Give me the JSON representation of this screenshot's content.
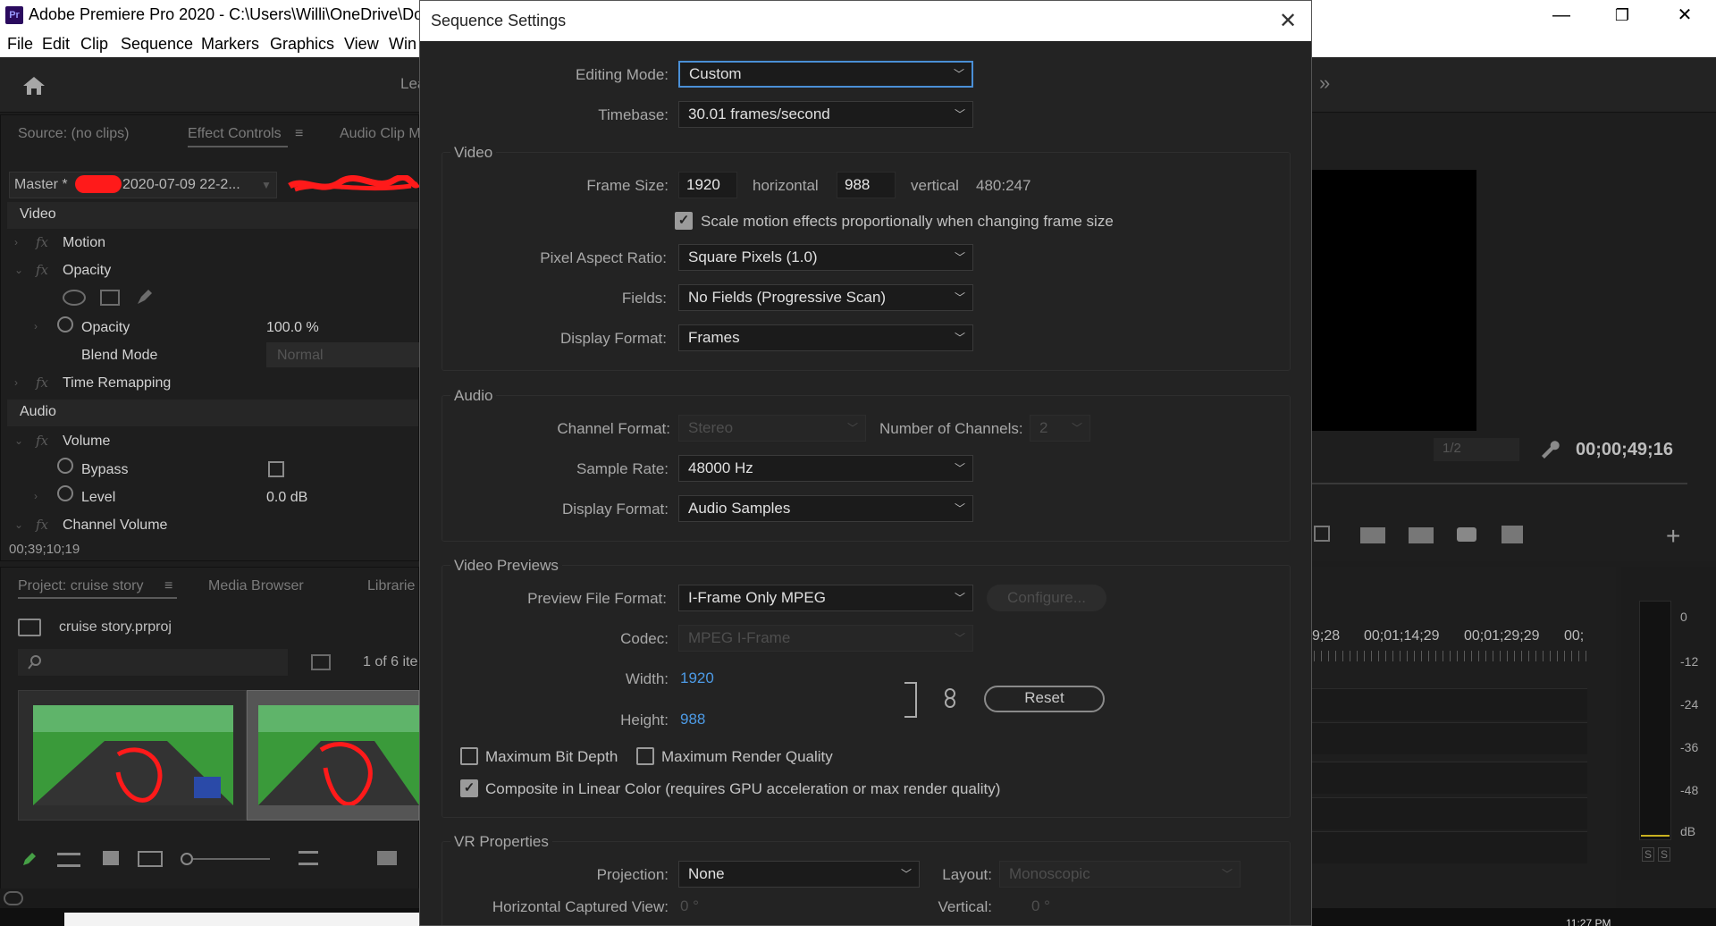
{
  "window": {
    "logo": "Pr",
    "title": "Adobe Premiere Pro 2020 - C:\\Users\\Willi\\OneDrive\\Do",
    "minimize": "—",
    "maximize": "❐",
    "close": "✕"
  },
  "menu": [
    "File",
    "Edit",
    "Clip",
    "Sequence",
    "Markers",
    "Graphics",
    "View",
    "Win"
  ],
  "workspace": {
    "partial_tab": "Lea",
    "overflow": "»"
  },
  "source_panel": {
    "tabs": [
      "Source: (no clips)",
      "Effect Controls",
      "Audio Clip M"
    ],
    "tab_menu": "≡",
    "master": "Master *",
    "clip": "2020-07-09 22-2...",
    "video_header": "Video",
    "motion": "Motion",
    "opacity_group": "Opacity",
    "opacity_label": "Opacity",
    "opacity_value": "100.0 %",
    "blend_mode_label": "Blend Mode",
    "blend_mode_value": "Normal",
    "time_remapping": "Time Remapping",
    "audio_header": "Audio",
    "volume": "Volume",
    "bypass": "Bypass",
    "level_label": "Level",
    "level_value": "0.0 dB",
    "channel_volume": "Channel Volume",
    "fx_symbol": "fx",
    "timecode": "00;39;10;19"
  },
  "project_panel": {
    "tabs": [
      "Project: cruise story",
      "Media Browser",
      "Librarie"
    ],
    "tab_menu": "≡",
    "project_file": "cruise story.prproj",
    "item_count": "1 of 6 ite",
    "search_placeholder": ""
  },
  "program_monitor": {
    "resolution": "1/2",
    "timecode": "00;00;49;16",
    "add": "+"
  },
  "timeline": {
    "times": [
      "9;28",
      "00;01;14;29",
      "00;01;29;29",
      "00;"
    ]
  },
  "audio_meter": {
    "labels": [
      "0",
      "-12",
      "-24",
      "-36",
      "-48",
      "dB"
    ],
    "solo_buttons": [
      "S",
      "S"
    ]
  },
  "dialog": {
    "title": "Sequence Settings",
    "close": "✕",
    "editing_mode_label": "Editing Mode:",
    "editing_mode_value": "Custom",
    "timebase_label": "Timebase:",
    "timebase_value": "30.01  frames/second",
    "video": {
      "title": "Video",
      "frame_size_label": "Frame Size:",
      "frame_width": "1920",
      "horizontal_label": "horizontal",
      "frame_height": "988",
      "vertical_label": "vertical",
      "aspect": "480:247",
      "scale_motion_label": "Scale motion effects proportionally when changing frame size",
      "scale_motion_checked": true,
      "pixel_aspect_label": "Pixel Aspect Ratio:",
      "pixel_aspect_value": "Square Pixels (1.0)",
      "fields_label": "Fields:",
      "fields_value": "No Fields (Progressive Scan)",
      "display_format_label": "Display Format:",
      "display_format_value": "Frames"
    },
    "audio": {
      "title": "Audio",
      "channel_format_label": "Channel Format:",
      "channel_format_value": "Stereo",
      "num_channels_label": "Number of Channels:",
      "num_channels_value": "2",
      "sample_rate_label": "Sample Rate:",
      "sample_rate_value": "48000 Hz",
      "display_format_label": "Display Format:",
      "display_format_value": "Audio Samples"
    },
    "previews": {
      "title": "Video Previews",
      "file_format_label": "Preview File Format:",
      "file_format_value": "I-Frame Only MPEG",
      "configure": "Configure...",
      "codec_label": "Codec:",
      "codec_value": "MPEG I-Frame",
      "width_label": "Width:",
      "width_value": "1920",
      "height_label": "Height:",
      "height_value": "988",
      "reset": "Reset",
      "max_bit_depth": "Maximum Bit Depth",
      "max_render_quality": "Maximum Render Quality",
      "composite_linear": "Composite in Linear Color (requires GPU acceleration or max render quality)",
      "composite_checked": true
    },
    "vr": {
      "title": "VR Properties",
      "projection_label": "Projection:",
      "projection_value": "None",
      "layout_label": "Layout:",
      "layout_value": "Monoscopic",
      "h_view_label": "Horizontal Captured View:",
      "h_view_value": "0 °",
      "vertical_label": "Vertical:",
      "vertical_value": "0 °"
    }
  },
  "taskbar": {
    "clock": "11:27 PM"
  },
  "colors": {
    "accent": "#4a8fd6",
    "dialog_bg": "#232323",
    "link_blue": "#4d9be6",
    "red_scribble": "#ff1a1a"
  }
}
